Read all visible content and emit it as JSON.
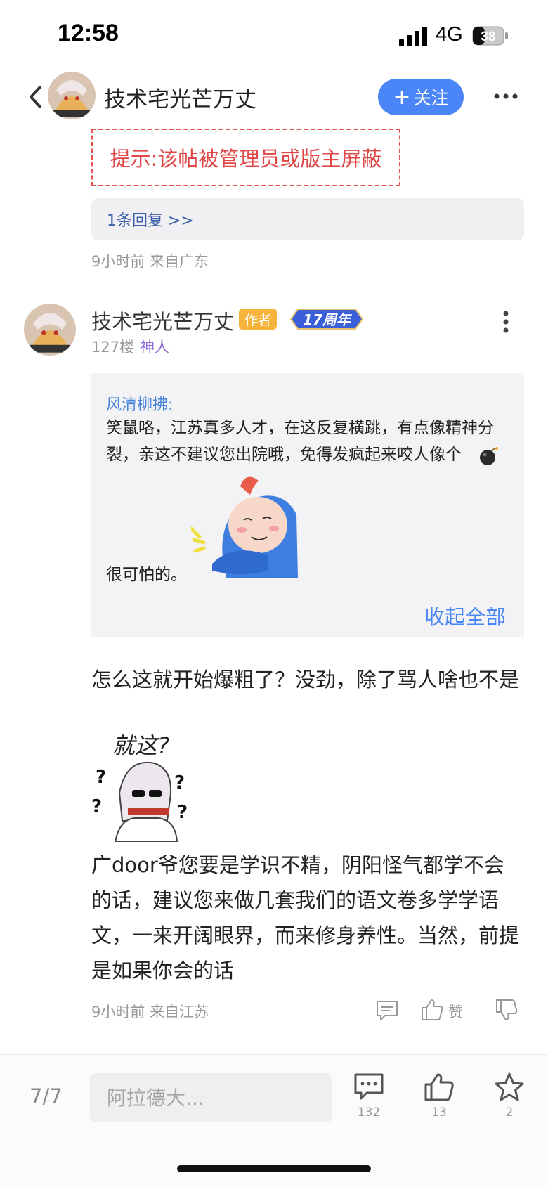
{
  "status_bar": {
    "time": "12:58",
    "network": "4G",
    "battery": "38"
  },
  "header": {
    "title": "技术宅光芒万丈",
    "follow_label": "关注",
    "follow_prefix": "+"
  },
  "notice": {
    "blocked_text": "提示:该帖被管理员或版主屏蔽",
    "reply_link": "1条回复 >>",
    "meta": "9小时前 来自广东"
  },
  "post": {
    "author": "技术宅光芒万丈",
    "author_tag": "作者",
    "anniversary_badge": "17周年",
    "floor": "127楼",
    "level": "神人",
    "quote": {
      "user": "风清柳拂:",
      "text": "笑鼠咯，江苏真多人才，在这反复横跳，有点像精神分裂，亲这不建议您出院哦，免得发疯起来咬人像个",
      "tail": "很可怕的。"
    },
    "collapse_label": "收起全部",
    "body_1": "怎么这就开始爆粗了？没劲，除了骂人啥也不是",
    "sticker_text": "就这?",
    "body_2": "广door爷您要是学识不精，阴阳怪气都学不会的话，建议您来做几套我们的语文卷多学学语文，一来开阔眼界，而来修身养性。当然，前提是如果你会的话",
    "meta": "9小时前 来自江苏",
    "like_label": "赞"
  },
  "bottom_bar": {
    "page_indicator": "7/7",
    "input_placeholder": "阿拉德大...",
    "comments_count": "132",
    "likes_count": "13",
    "favorites_count": "2"
  },
  "colors": {
    "accent": "#4a86f7",
    "notice_red": "#e04848",
    "link_blue": "#3d5ea8",
    "level_purple": "#8e6bd6",
    "author_tag": "#f5b43c"
  }
}
